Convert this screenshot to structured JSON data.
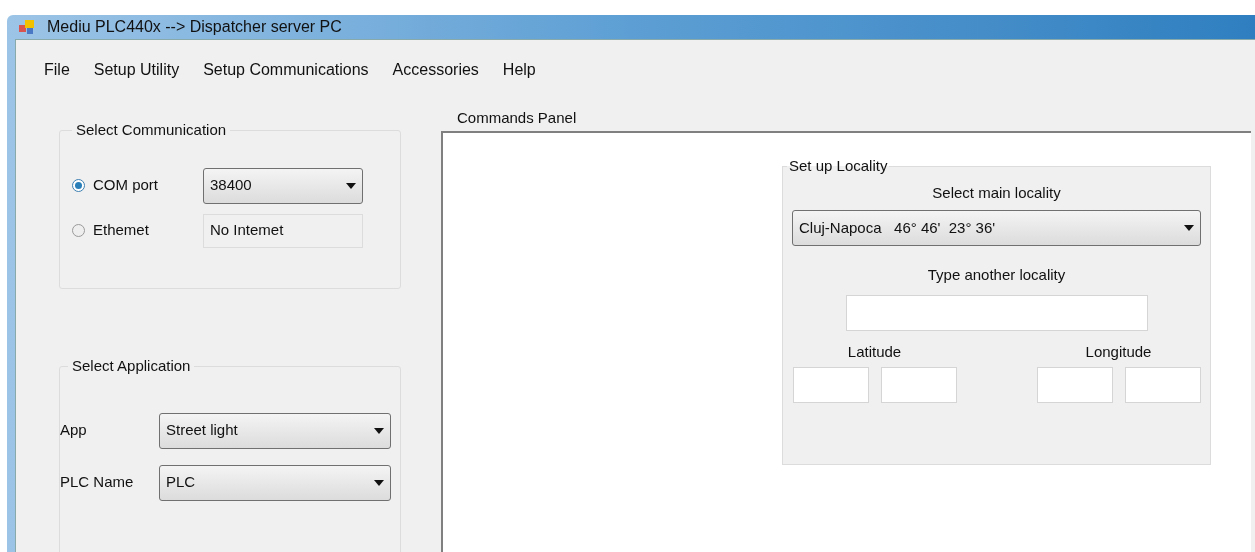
{
  "window": {
    "title": "Mediu PLC440x --> Dispatcher server PC"
  },
  "menu": [
    "File",
    "Setup Utility",
    "Setup Communications",
    "Accessories",
    "Help"
  ],
  "communication": {
    "title": "Select Communication",
    "options": [
      {
        "label": "COM port",
        "selected": true,
        "kind": "combo",
        "value": "38400"
      },
      {
        "label": "Ethemet",
        "selected": false,
        "kind": "readonly",
        "value": "No Intemet"
      }
    ]
  },
  "application": {
    "title": "Select Application",
    "fields": [
      {
        "label": "App",
        "value": "Street light"
      },
      {
        "label": "PLC Name",
        "value": "PLC"
      }
    ]
  },
  "commands_panel": {
    "title": "Commands Panel",
    "locality": {
      "title": "Set up Locality",
      "main_label": "Select main locality",
      "main_value": "Cluj-Napoca   46° 46'  23° 36'",
      "other_label": "Type another locality",
      "latitude_label": "Latitude",
      "longitude_label": "Longitude"
    }
  }
}
